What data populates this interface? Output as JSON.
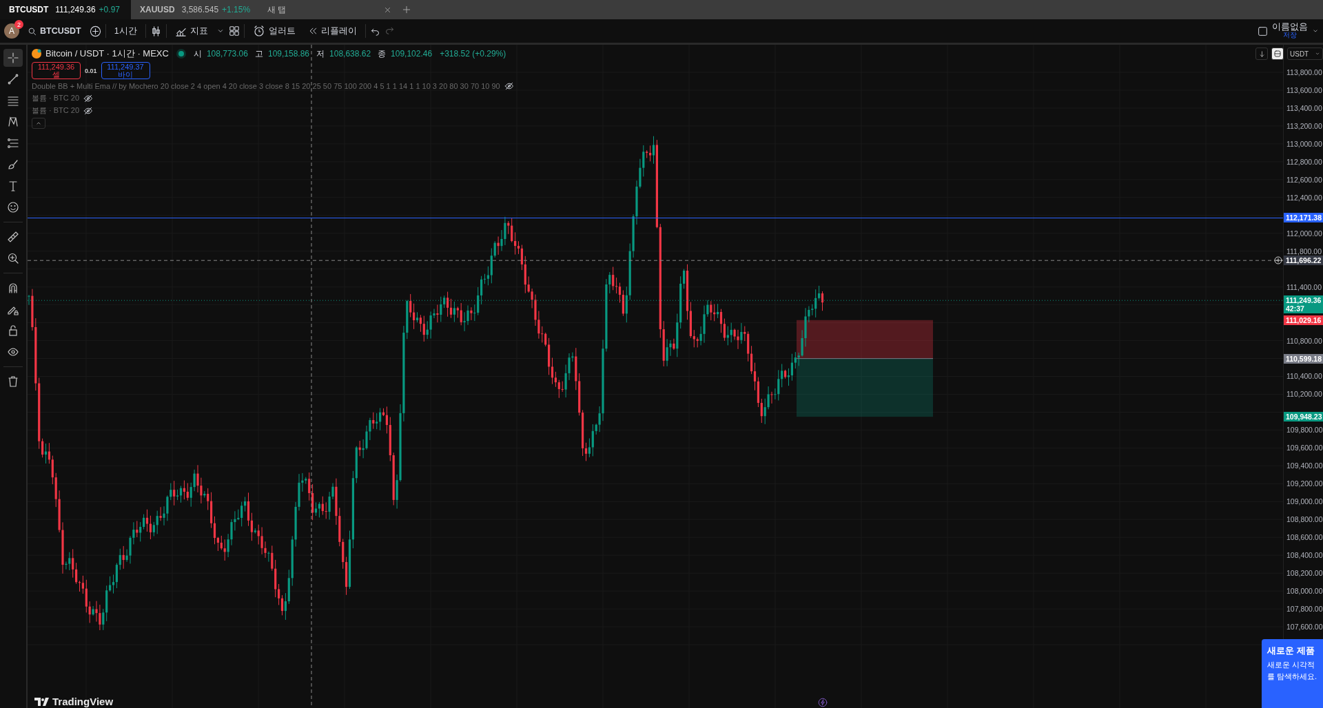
{
  "tabs": [
    {
      "symbol": "BTCUSDT",
      "price": "111,249.36",
      "change": "+0.97",
      "selected": true
    },
    {
      "symbol": "XAUUSD",
      "price": "3,586.545",
      "change": "+1.15%",
      "selected": false
    },
    {
      "title": "새 탭",
      "selected": false
    }
  ],
  "toolbar": {
    "avatar": "A",
    "notifications": "2",
    "symbol": "BTCUSDT",
    "interval": "1시간",
    "indicators": "지표",
    "alert": "얼러트",
    "replay": "리플레이",
    "layout_name": "이름없음",
    "save": "저장"
  },
  "left_tools": [
    {
      "kind": "crosshair",
      "selected": true
    },
    {
      "kind": "trend-line",
      "selected": false
    },
    {
      "kind": "parallel-lines",
      "selected": false
    },
    {
      "kind": "pattern",
      "selected": false
    },
    {
      "kind": "fib",
      "selected": false
    },
    {
      "kind": "brush",
      "selected": false
    },
    {
      "kind": "text",
      "selected": false
    },
    {
      "kind": "emoji",
      "selected": false
    },
    {
      "kind": "ruler",
      "selected": false
    },
    {
      "kind": "zoom",
      "selected": false
    },
    {
      "kind": "magnet",
      "selected": false
    },
    {
      "kind": "pencil-lock",
      "selected": false
    },
    {
      "kind": "lock",
      "selected": false
    },
    {
      "kind": "eye",
      "selected": false
    },
    {
      "kind": "trash",
      "selected": false
    }
  ],
  "legend": {
    "title": "Bitcoin / USDT · 1시간 · MEXC",
    "ohlc": [
      {
        "label": "시",
        "value": "108,773.06"
      },
      {
        "label": "고",
        "value": "109,158.86"
      },
      {
        "label": "저",
        "value": "108,638.62"
      },
      {
        "label": "종",
        "value": "109,102.46"
      }
    ],
    "change": "+318.52 (+0.29%)",
    "sell": {
      "price": "111,249.36",
      "label": "셀"
    },
    "quantity": "0.01",
    "buy": {
      "price": "111,249.37",
      "label": "바이"
    },
    "indicators": [
      {
        "text": "Double BB + Multi Ema // by Mochero 20 close 2 4 open 4 20 close 3 close 8 15 20 25 50 75 100 200 4 5 1 1 14 1 1 10 3 20 80 30 70 10 90"
      },
      {
        "text": "볼륨 · BTC 20"
      },
      {
        "text": "볼륨 · BTC 20"
      }
    ]
  },
  "chart_controls": {
    "currency": "USDT"
  },
  "price_axis": {
    "ticks": [
      "113,800.00",
      "113,600.00",
      "113,400.00",
      "113,200.00",
      "113,000.00",
      "112,800.00",
      "112,600.00",
      "112,400.00",
      "112,000.00",
      "111,800.00",
      "111,400.00",
      "110,800.00",
      "110,400.00",
      "110,200.00",
      "109,800.00",
      "109,600.00",
      "109,400.00",
      "109,200.00",
      "109,000.00",
      "108,800.00",
      "108,600.00",
      "108,400.00",
      "108,200.00",
      "108,000.00",
      "107,800.00",
      "107,600.00"
    ],
    "markers": [
      {
        "kind": "line",
        "price": "112,171.38",
        "color": "#2962ff"
      },
      {
        "kind": "crosshair",
        "price": "111,696.22",
        "color": "#363a45"
      },
      {
        "kind": "last",
        "price": "111,249.36",
        "countdown": "42:37",
        "color": "#089981"
      },
      {
        "kind": "stop",
        "price": "111,029.16",
        "color": "#f23645"
      },
      {
        "kind": "entry",
        "price": "110,599.18",
        "color": "#787b86"
      },
      {
        "kind": "target",
        "price": "109,948.23",
        "color": "#089981"
      }
    ]
  },
  "branding": "TradingView",
  "promo": {
    "title": "새로운 제품",
    "lines": [
      "새로운 시각적",
      "를 탐색하세요."
    ]
  }
}
